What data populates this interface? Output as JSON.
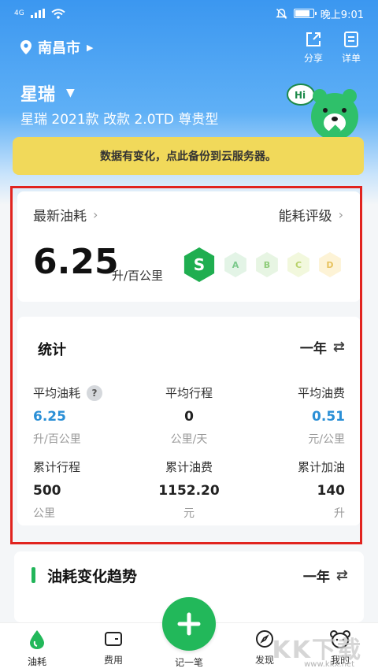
{
  "status_bar": {
    "network": "4G",
    "time": "晚上9:01",
    "battery_level": 0.85
  },
  "header": {
    "city": "南昌市",
    "share_label": "分享",
    "detail_label": "详单"
  },
  "car": {
    "name": "星瑞",
    "model": "星瑞 2021款 改款 2.0TD 尊贵型",
    "mascot_bubble": "Hi"
  },
  "notice": {
    "text": "数据有变化，点此备份到云服务器。"
  },
  "fuel_card": {
    "latest_label": "最新油耗",
    "rating_label": "能耗评级",
    "value": "6.25",
    "unit": "升/百公里",
    "grades": [
      {
        "letter": "S",
        "active": true
      },
      {
        "letter": "A",
        "active": false
      },
      {
        "letter": "B",
        "active": false
      },
      {
        "letter": "C",
        "active": false
      },
      {
        "letter": "D",
        "active": false
      }
    ],
    "colors": {
      "active": "#1fae50",
      "A": "#e3f4e6",
      "B": "#e7f5e3",
      "C": "#f2f8dd",
      "D": "#fdf3d6",
      "inactive_text_A": "#7cc98c",
      "inactive_text_B": "#8fcc7a",
      "inactive_text_C": "#b8d26a",
      "inactive_text_D": "#e7c25e"
    }
  },
  "stats": {
    "title": "统计",
    "period": "一年",
    "items": [
      {
        "label": "平均油耗",
        "value": "6.25",
        "unit": "升/百公里",
        "color": "#2a8fd6",
        "help": "?"
      },
      {
        "label": "平均行程",
        "value": "0",
        "unit": "公里/天",
        "color": "#222222"
      },
      {
        "label": "平均油费",
        "value": "0.51",
        "unit": "元/公里",
        "color": "#2a8fd6"
      },
      {
        "label": "累计行程",
        "value": "500",
        "unit": "公里",
        "color": "#222222"
      },
      {
        "label": "累计油费",
        "value": "1152.20",
        "unit": "元",
        "color": "#222222"
      },
      {
        "label": "累计加油",
        "value": "140",
        "unit": "升",
        "color": "#222222"
      }
    ]
  },
  "trend": {
    "title": "油耗变化趋势",
    "period": "一年"
  },
  "tabbar": {
    "items": [
      "油耗",
      "费用",
      "记一笔",
      "发现",
      "我的"
    ]
  },
  "watermark": {
    "text": "KK下载",
    "sub": "www.kkx.net"
  }
}
